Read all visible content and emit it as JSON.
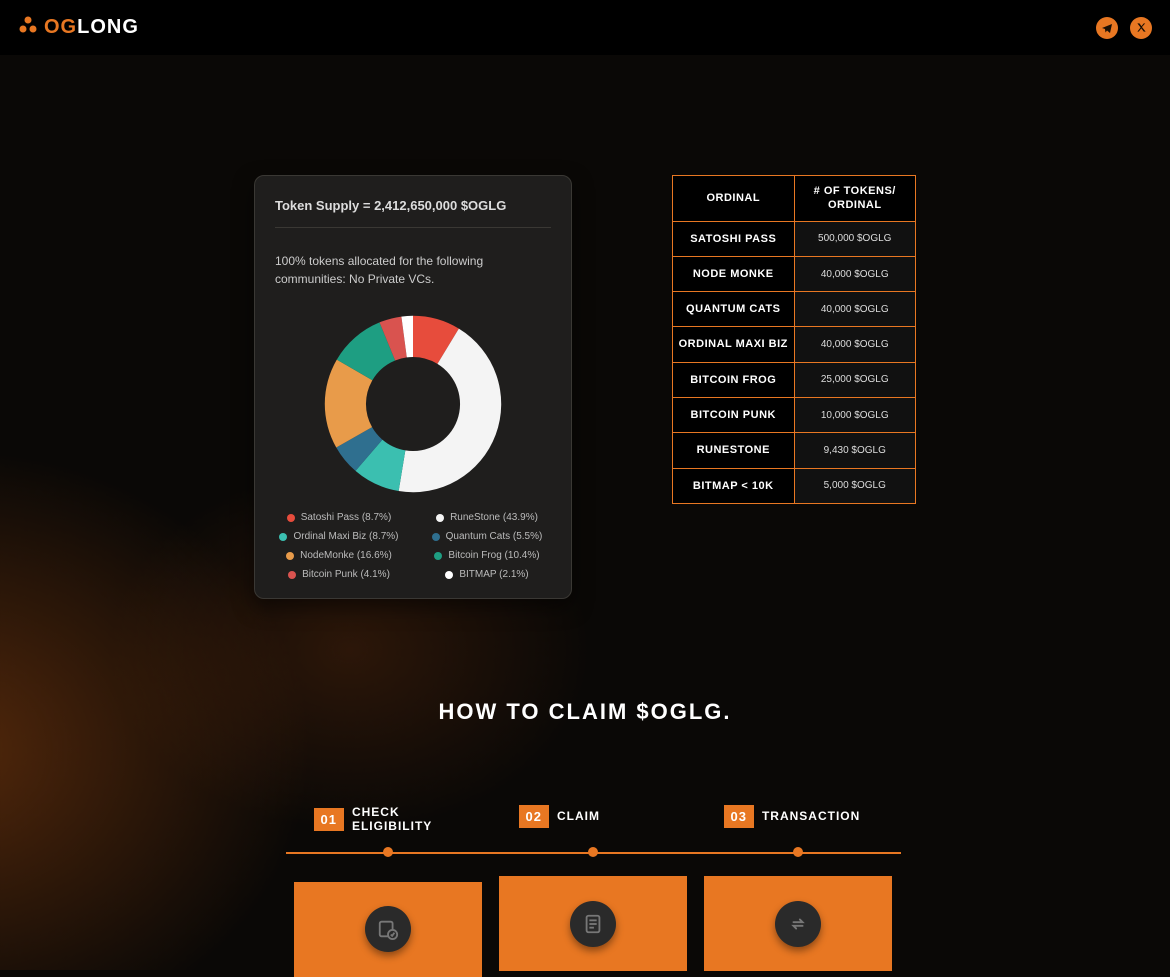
{
  "header": {
    "brand_part1": "OG",
    "brand_part2": "LONG"
  },
  "supply_card": {
    "title": "Token Supply = 2,412,650,000 $OGLG",
    "subtitle": "100% tokens allocated for the following communities: No Private VCs."
  },
  "chart_data": {
    "type": "pie",
    "title": "Token Allocation",
    "series": [
      {
        "name": "Satoshi Pass",
        "value": 8.7,
        "color": "#e74c3c"
      },
      {
        "name": "RuneStone",
        "value": 43.9,
        "color": "#f4f4f4"
      },
      {
        "name": "Ordinal Maxi Biz",
        "value": 8.7,
        "color": "#3bbfb0"
      },
      {
        "name": "Quantum Cats",
        "value": 5.5,
        "color": "#2f6f8f"
      },
      {
        "name": "NodeMonke",
        "value": 16.6,
        "color": "#e89b4a"
      },
      {
        "name": "Bitcoin Frog",
        "value": 10.4,
        "color": "#1e9e82"
      },
      {
        "name": "Bitcoin Punk",
        "value": 4.1,
        "color": "#d9534f"
      },
      {
        "name": "BITMAP",
        "value": 2.1,
        "color": "#ffffff"
      }
    ],
    "legend_labels": [
      "Satoshi Pass (8.7%)",
      "RuneStone (43.9%)",
      "Ordinal Maxi Biz (8.7%)",
      "Quantum Cats (5.5%)",
      "NodeMonke (16.6%)",
      "Bitcoin Frog (10.4%)",
      "Bitcoin Punk (4.1%)",
      "BITMAP (2.1%)"
    ]
  },
  "table": {
    "headers": [
      "ORDINAL",
      "# OF TOKENS/ ORDINAL"
    ],
    "rows": [
      {
        "ordinal": "SATOSHI PASS",
        "tokens": "500,000 $OGLG"
      },
      {
        "ordinal": "NODE MONKE",
        "tokens": "40,000 $OGLG"
      },
      {
        "ordinal": "QUANTUM CATS",
        "tokens": "40,000 $OGLG"
      },
      {
        "ordinal": "ORDINAL MAXI BIZ",
        "tokens": "40,000 $OGLG"
      },
      {
        "ordinal": "BITCOIN FROG",
        "tokens": "25,000 $OGLG"
      },
      {
        "ordinal": "BITCOIN PUNK",
        "tokens": "10,000 $OGLG"
      },
      {
        "ordinal": "RUNESTONE",
        "tokens": "9,430 $OGLG"
      },
      {
        "ordinal": "BITMAP < 10K",
        "tokens": "5,000 $OGLG"
      }
    ]
  },
  "howto": {
    "title": "HOW TO CLAIM $OGLG.",
    "steps": [
      {
        "num": "01",
        "label": "CHECK ELIGIBILITY"
      },
      {
        "num": "02",
        "label": "CLAIM"
      },
      {
        "num": "03",
        "label": "TRANSACTION"
      }
    ]
  }
}
